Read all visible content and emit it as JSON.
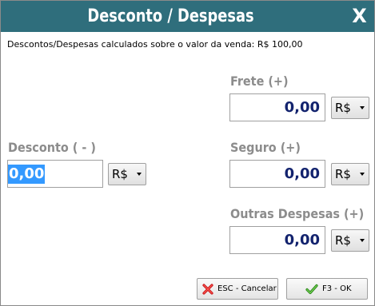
{
  "window": {
    "title": "Desconto / Despesas",
    "close_label": "X"
  },
  "subtitle": "Descontos/Despesas calculados sobre o valor da venda: R$ 100,00",
  "desconto": {
    "label": "Desconto ( - )",
    "value": "0,00",
    "currency": "R$"
  },
  "frete": {
    "label": "Frete (+)",
    "value": "0,00",
    "currency": "R$"
  },
  "seguro": {
    "label": "Seguro (+)",
    "value": "0,00",
    "currency": "R$"
  },
  "outras": {
    "label": "Outras Despesas (+)",
    "value": "0,00",
    "currency": "R$"
  },
  "buttons": {
    "cancel_label": "ESC - Cancelar",
    "ok_label": "F3 - OK"
  },
  "icons": {
    "cancel": "red-x-icon",
    "ok": "green-check-icon"
  },
  "colors": {
    "titlebar": "#2f6e7c",
    "label_gray": "#8c8c8c",
    "value_navy": "#13236e",
    "selection": "#3399ff"
  }
}
